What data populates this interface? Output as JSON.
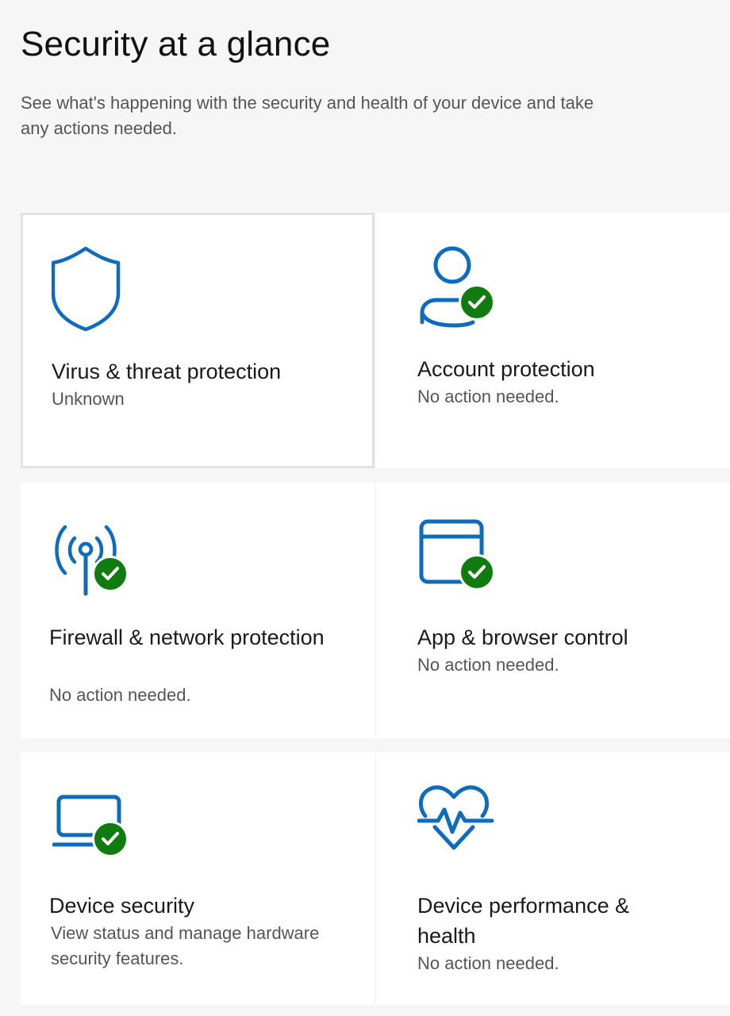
{
  "page": {
    "title": "Security at a glance",
    "subtitle": "See what's happening with the security and health of your device and take any actions needed."
  },
  "colors": {
    "accent": "#0f6cbd",
    "ok": "#107c10",
    "background": "#f6f6f6",
    "tile": "#ffffff"
  },
  "tiles": [
    {
      "title": "Virus & threat protection",
      "status": "Unknown",
      "icon": "shield-icon",
      "has_check": false,
      "selected": true
    },
    {
      "title": "Account protection",
      "status": "No action needed.",
      "icon": "person-icon",
      "has_check": true,
      "selected": false
    },
    {
      "title": "Firewall & network protection",
      "status": "No action needed.",
      "icon": "antenna-icon",
      "has_check": true,
      "selected": false
    },
    {
      "title": "App & browser control",
      "status": "No action needed.",
      "icon": "browser-window-icon",
      "has_check": true,
      "selected": false
    },
    {
      "title": "Device security",
      "status": "View status and manage hardware security features.",
      "icon": "laptop-icon",
      "has_check": true,
      "selected": false
    },
    {
      "title": "Device performance & health",
      "status": "No action needed.",
      "icon": "heart-pulse-icon",
      "has_check": false,
      "selected": false
    }
  ]
}
